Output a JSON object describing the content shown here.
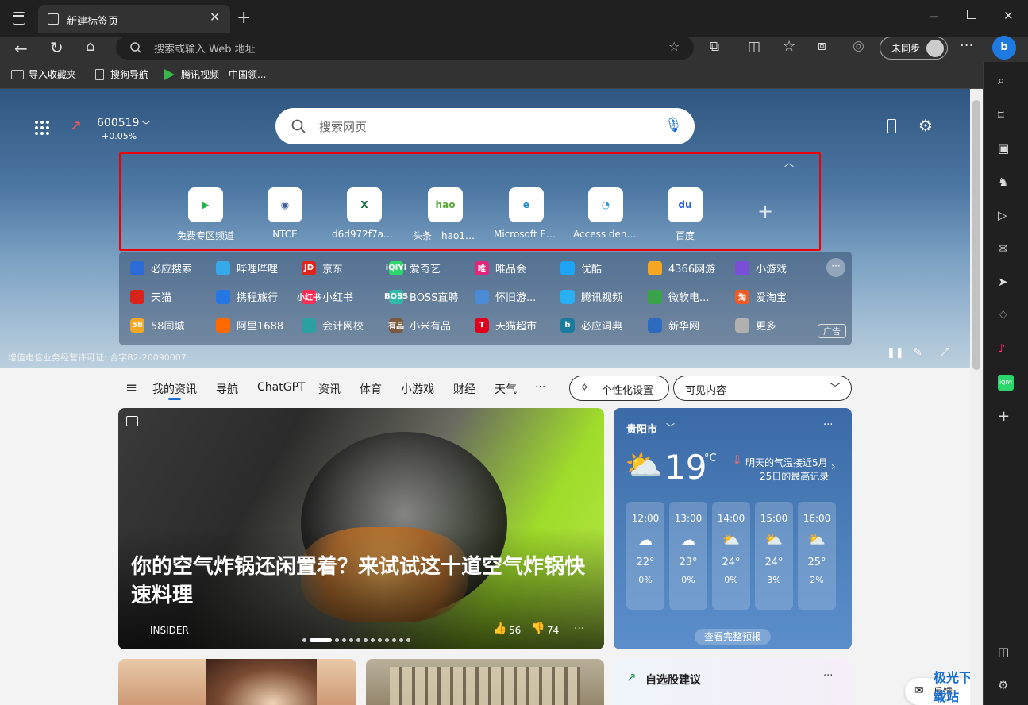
{
  "tab": {
    "title": "新建标签页"
  },
  "address": {
    "placeholder": "搜索或输入 Web 地址"
  },
  "profile": {
    "label": "未同步"
  },
  "bookmarks": [
    {
      "label": "导入收藏夹"
    },
    {
      "label": "搜狗导航"
    },
    {
      "label": "腾讯视频 - 中国领..."
    }
  ],
  "stock": {
    "code": "600519",
    "change": "+0.05%"
  },
  "search": {
    "placeholder": "搜索网页"
  },
  "tiles": [
    {
      "label": "免费专区频道",
      "icon": "tencent-video-icon"
    },
    {
      "label": "NTCE",
      "icon": "ntce-icon"
    },
    {
      "label": "d6d972f7acd...",
      "icon": "excel-icon"
    },
    {
      "label": "头条__hao12...",
      "icon": "hao123-icon"
    },
    {
      "label": "Microsoft Ed...",
      "icon": "edge-icon"
    },
    {
      "label": "Access denied",
      "icon": "access-icon"
    },
    {
      "label": "百度",
      "icon": "baidu-icon"
    }
  ],
  "quicklinks": [
    {
      "label": "必应搜索",
      "badge": "",
      "color": "#2b6cd9"
    },
    {
      "label": "哔哩哔哩",
      "badge": "",
      "color": "#37a9e8"
    },
    {
      "label": "京东",
      "badge": "JD",
      "color": "#e1251b"
    },
    {
      "label": "爱奇艺",
      "badge": "iQIYI",
      "color": "#2bd66b"
    },
    {
      "label": "唯品会",
      "badge": "唯",
      "color": "#e4257c"
    },
    {
      "label": "优酷",
      "badge": "",
      "color": "#1fa3f5"
    },
    {
      "label": "4366网游",
      "badge": "",
      "color": "#f5a623"
    },
    {
      "label": "小游戏",
      "badge": "",
      "color": "#7a4fd8"
    },
    {
      "label": "天猫",
      "badge": "",
      "color": "#d8221c"
    },
    {
      "label": "携程旅行",
      "badge": "",
      "color": "#2577e3"
    },
    {
      "label": "小红书",
      "badge": "小红书",
      "color": "#fe2c55"
    },
    {
      "label": "BOSS直聘",
      "badge": "BOSS",
      "color": "#34b8a8"
    },
    {
      "label": "怀旧游...",
      "badge": "",
      "color": "#4a8cd8"
    },
    {
      "label": "腾讯视频",
      "badge": "",
      "color": "#29b0f2"
    },
    {
      "label": "微软电...",
      "badge": "",
      "color": "#3aa34a"
    },
    {
      "label": "爱淘宝",
      "badge": "淘",
      "color": "#f05a24"
    },
    {
      "label": "58同城",
      "badge": "58",
      "color": "#f5a623"
    },
    {
      "label": "阿里1688",
      "badge": "",
      "color": "#ff6a00"
    },
    {
      "label": "会计网校",
      "badge": "",
      "color": "#2aa0a0"
    },
    {
      "label": "小米有品",
      "badge": "有品",
      "color": "#7a5b3f"
    },
    {
      "label": "天猫超市",
      "badge": "T",
      "color": "#e0001b"
    },
    {
      "label": "必应词典",
      "badge": "b",
      "color": "#1a7c9c"
    },
    {
      "label": "新华网",
      "badge": "",
      "color": "#2e6bbd"
    },
    {
      "label": "更多",
      "badge": "",
      "color": "#b0b0b0"
    }
  ],
  "ad_label": "广告",
  "license": "增值电信业务经营许可证: 合字B2-20090007",
  "feed_nav": [
    "我的资讯",
    "导航",
    "ChatGPT",
    "资讯",
    "体育",
    "小游戏",
    "财经",
    "天气",
    "···"
  ],
  "personalize": "个性化设置",
  "visible": "可见内容",
  "article": {
    "title": "你的空气炸锅还闲置着？来试试这十道空气炸锅快速料理",
    "source": "INSIDER",
    "likes": "56",
    "dislikes": "74"
  },
  "weather": {
    "city": "贵阳市",
    "temp": "19",
    "unit": "°C",
    "note1": "明天的气温接近5月",
    "note2": "25日的最高记录",
    "link": "查看完整预报",
    "hours": [
      {
        "t": "12:00",
        "temp": "22°",
        "rain": "0%"
      },
      {
        "t": "13:00",
        "temp": "23°",
        "rain": "0%"
      },
      {
        "t": "14:00",
        "temp": "24°",
        "rain": "0%"
      },
      {
        "t": "15:00",
        "temp": "24°",
        "rain": "3%"
      },
      {
        "t": "16:00",
        "temp": "25°",
        "rain": "2%"
      }
    ]
  },
  "stocks_card": {
    "title": "自选股建议"
  },
  "feedback": "反馈",
  "watermark": "极光下载站"
}
